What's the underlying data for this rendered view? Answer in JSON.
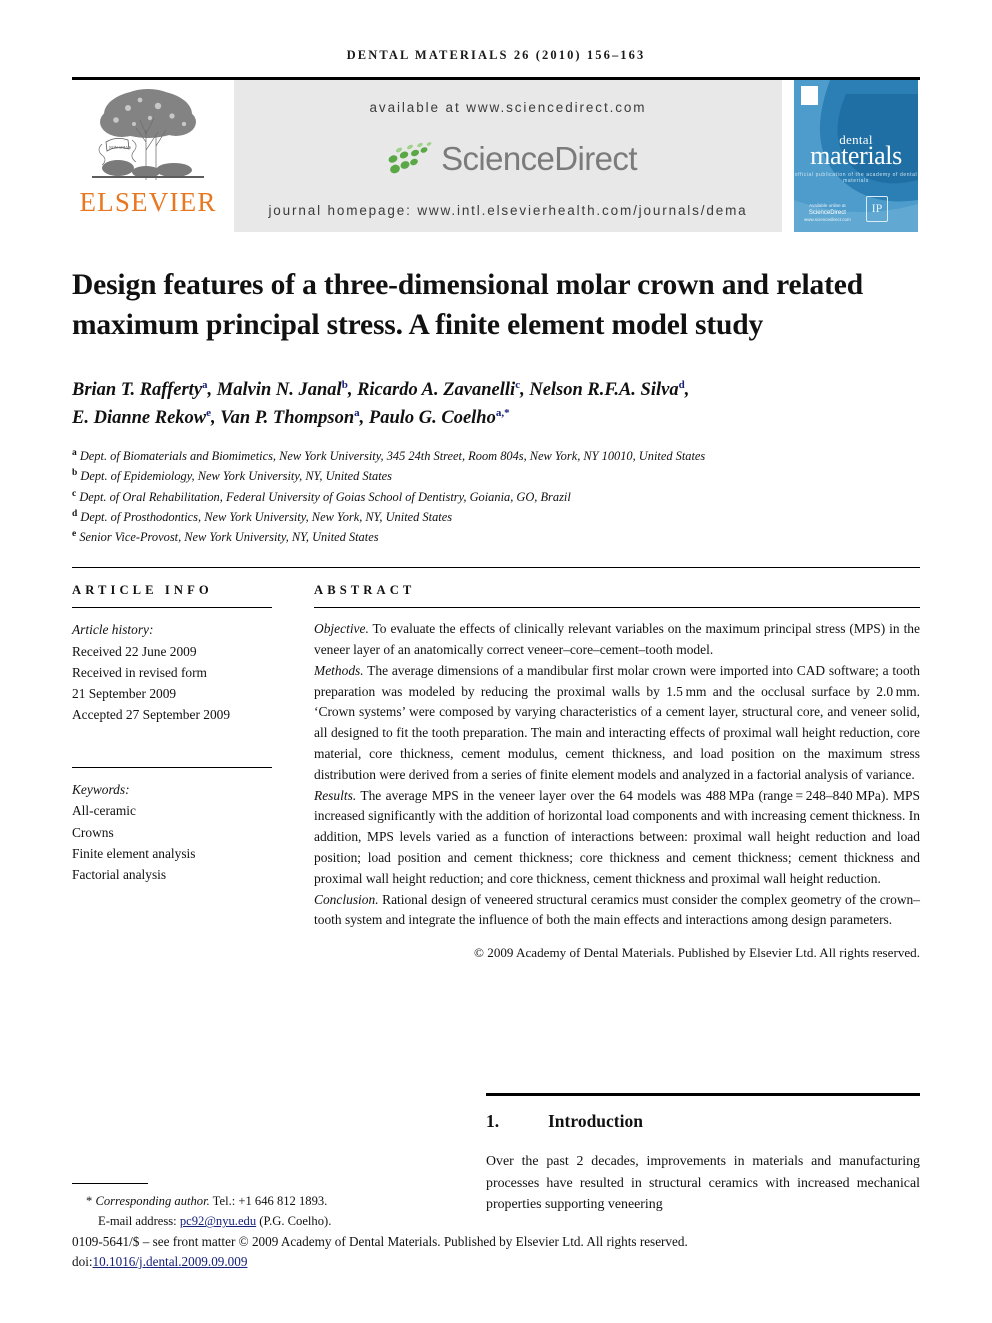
{
  "running_head": "Dental materials 26 (2010) 156–163",
  "masthead": {
    "publisher_logo_text": "ELSEVIER",
    "available_at": "available at www.sciencedirect.com",
    "sciencedirect_wordmark": "ScienceDirect",
    "journal_homepage": "journal homepage: www.intl.elsevierhealth.com/journals/dema",
    "cover": {
      "line1": "dental",
      "line2": "materials",
      "subtitle": "official publication of the academy of dental materials",
      "sciencedirect_label": "Available online at",
      "sciencedirect_name": "ScienceDirect",
      "sciencedirect_url": "www.sciencedirect.com",
      "badge": "IP"
    },
    "accent_orange": "#E87722",
    "cover_blue": "#4a97c8",
    "banner_gray": "#e8e8e8"
  },
  "title": "Design features of a three-dimensional molar crown and related maximum principal stress. A finite element model study",
  "authors": [
    {
      "name": "Brian T. Rafferty",
      "marks": "a"
    },
    {
      "name": "Malvin N. Janal",
      "marks": "b"
    },
    {
      "name": "Ricardo A. Zavanelli",
      "marks": "c"
    },
    {
      "name": "Nelson R.F.A. Silva",
      "marks": "d"
    },
    {
      "name": "E. Dianne Rekow",
      "marks": "e"
    },
    {
      "name": "Van P. Thompson",
      "marks": "a"
    },
    {
      "name": "Paulo G. Coelho",
      "marks": "a,*"
    }
  ],
  "affiliations": [
    {
      "mark": "a",
      "text": "Dept. of Biomaterials and Biomimetics, New York University, 345 24th Street, Room 804s, New York, NY 10010, United States"
    },
    {
      "mark": "b",
      "text": "Dept. of Epidemiology, New York University, NY, United States"
    },
    {
      "mark": "c",
      "text": "Dept. of Oral Rehabilitation, Federal University of Goias School of Dentistry, Goiania, GO, Brazil"
    },
    {
      "mark": "d",
      "text": "Dept. of Prosthodontics, New York University, New York, NY, United States"
    },
    {
      "mark": "e",
      "text": "Senior Vice-Provost, New York University, NY, United States"
    }
  ],
  "article_info": {
    "heading": "ARTICLE INFO",
    "history_label": "Article history:",
    "history": [
      "Received 22 June 2009",
      "Received in revised form",
      "21 September 2009",
      "Accepted 27 September 2009"
    ],
    "keywords_label": "Keywords:",
    "keywords": [
      "All-ceramic",
      "Crowns",
      "Finite element analysis",
      "Factorial analysis"
    ]
  },
  "abstract": {
    "heading": "ABSTRACT",
    "objective_label": "Objective.",
    "objective_text": " To evaluate the effects of clinically relevant variables on the maximum principal stress (MPS) in the veneer layer of an anatomically correct veneer–core–cement–tooth model.",
    "methods_label": "Methods.",
    "methods_text": " The average dimensions of a mandibular first molar crown were imported into CAD software; a tooth preparation was modeled by reducing the proximal walls by 1.5 mm and the occlusal surface by 2.0 mm. ‘Crown systems’ were composed by varying characteristics of a cement layer, structural core, and veneer solid, all designed to fit the tooth preparation. The main and interacting effects of proximal wall height reduction, core material, core thickness, cement modulus, cement thickness, and load position on the maximum stress distribution were derived from a series of finite element models and analyzed in a factorial analysis of variance.",
    "results_label": "Results.",
    "results_text": " The average MPS in the veneer layer over the 64 models was 488 MPa (range = 248–840 MPa). MPS increased significantly with the addition of horizontal load components and with increasing cement thickness. In addition, MPS levels varied as a function of interactions between: proximal wall height reduction and load position; load position and cement thickness; core thickness and cement thickness; cement thickness and proximal wall height reduction; and core thickness, cement thickness and proximal wall height reduction.",
    "conclusion_label": "Conclusion.",
    "conclusion_text": " Rational design of veneered structural ceramics must consider the complex geometry of the crown–tooth system and integrate the influence of both the main effects and interactions among design parameters.",
    "copyright": "© 2009 Academy of Dental Materials. Published by Elsevier Ltd. All rights reserved."
  },
  "introduction": {
    "number": "1.",
    "heading": "Introduction",
    "paragraph": "Over the past 2 decades, improvements in materials and manufacturing processes have resulted in structural ceramics with increased mechanical properties supporting veneering"
  },
  "footnote": {
    "star": "*",
    "corresponding_label": "Corresponding author.",
    "tel": " Tel.: +1 646 812 1893.",
    "email_label": "E-mail address:",
    "email": "pc92@nyu.edu",
    "email_owner": " (P.G. Coelho)."
  },
  "bottom": {
    "issn_line": "0109-5641/$ – see front matter © 2009 Academy of Dental Materials. Published by Elsevier Ltd. All rights reserved.",
    "doi_prefix": "doi:",
    "doi": "10.1016/j.dental.2009.09.009"
  }
}
